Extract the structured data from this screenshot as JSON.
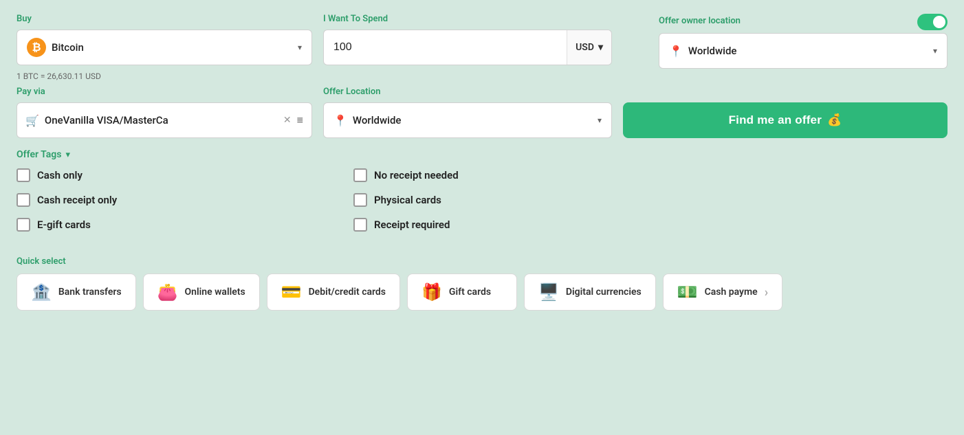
{
  "buy": {
    "label": "Buy",
    "selected": "Bitcoin",
    "icon": "₿"
  },
  "spend": {
    "label": "I Want To Spend",
    "amount": "100",
    "currency": "USD"
  },
  "owner_location": {
    "label": "Offer owner location",
    "selected": "Worldwide",
    "toggle_on": true
  },
  "exchange_rate": "1 BTC = 26,630.11 USD",
  "pay_via": {
    "label": "Pay via",
    "selected": "OneVanilla VISA/MasterCa"
  },
  "offer_location": {
    "label": "Offer Location",
    "selected": "Worldwide"
  },
  "find_button": {
    "label": "Find me an offer",
    "icon": "💰"
  },
  "offer_tags": {
    "label": "Offer Tags",
    "left_items": [
      {
        "id": "cash-only",
        "label": "Cash only"
      },
      {
        "id": "cash-receipt-only",
        "label": "Cash receipt only"
      },
      {
        "id": "e-gift-cards",
        "label": "E-gift cards"
      }
    ],
    "right_items": [
      {
        "id": "no-receipt-needed",
        "label": "No receipt needed"
      },
      {
        "id": "physical-cards",
        "label": "Physical cards"
      },
      {
        "id": "receipt-required",
        "label": "Receipt required"
      }
    ]
  },
  "quick_select": {
    "label": "Quick select",
    "items": [
      {
        "id": "bank-transfers",
        "label": "Bank transfers",
        "icon": "🏦"
      },
      {
        "id": "online-wallets",
        "label": "Online wallets",
        "icon": "👛"
      },
      {
        "id": "debit-credit-cards",
        "label": "Debit/credit cards",
        "icon": "💳"
      },
      {
        "id": "gift-cards",
        "label": "Gift cards",
        "icon": "🎁"
      },
      {
        "id": "digital-currencies",
        "label": "Digital currencies",
        "icon": "🖥️"
      },
      {
        "id": "cash-payments",
        "label": "Cash payments",
        "icon": "💵"
      }
    ]
  }
}
